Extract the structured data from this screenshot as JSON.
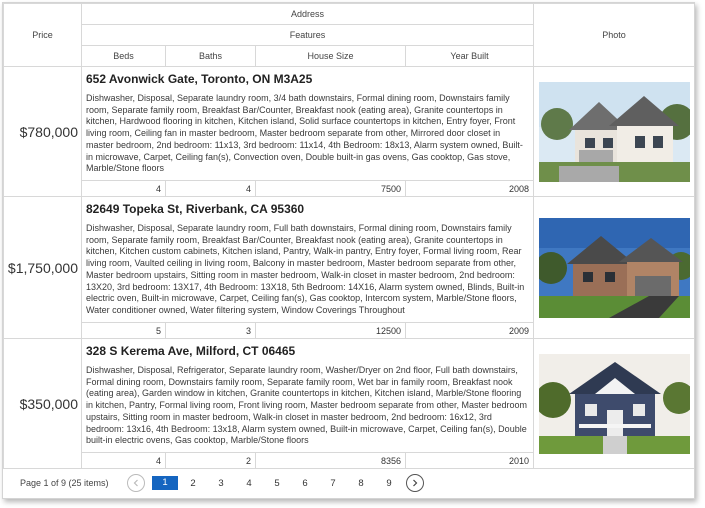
{
  "header": {
    "price": "Price",
    "address": "Address",
    "features": "Features",
    "beds": "Beds",
    "baths": "Baths",
    "house_size": "House Size",
    "year_built": "Year Built",
    "photo": "Photo"
  },
  "rows": [
    {
      "price": "$780,000",
      "address": "652 Avonwick Gate, Toronto, ON M3A25",
      "features": "Dishwasher, Disposal, Separate laundry room, 3/4 bath downstairs, Formal dining room, Downstairs family room, Separate family room, Breakfast Bar/Counter, Breakfast nook (eating area), Granite countertops in kitchen, Hardwood flooring in kitchen, Kitchen island, Solid surface countertops in kitchen, Entry foyer, Front living room, Ceiling fan in master bedroom, Master bedroom separate from other, Mirrored door closet in master bedroom, 2nd bedroom: 11x13, 3rd bedroom: 11x14, 4th Bedroom: 18x13, Alarm system owned, Built-in microwave, Carpet, Ceiling fan(s), Convection oven, Double built-in gas ovens, Gas cooktop, Gas stove, Marble/Stone floors",
      "beds": "4",
      "baths": "4",
      "house_size": "7500",
      "year_built": "2008"
    },
    {
      "price": "$1,750,000",
      "address": "82649 Topeka St, Riverbank, CA 95360",
      "features": "Dishwasher, Disposal, Separate laundry room, Full bath downstairs, Formal dining room, Downstairs family room, Separate family room, Breakfast Bar/Counter, Breakfast nook (eating area), Granite countertops in kitchen, Kitchen custom cabinets, Kitchen island, Pantry, Walk-in pantry, Entry foyer, Formal living room, Rear living room, Vaulted ceiling in living room, Balcony in master bedroom, Master bedroom separate from other, Master bedroom upstairs, Sitting room in master bedroom, Walk-in closet in master bedroom, 2nd bedroom: 13X20, 3rd bedroom: 13X17, 4th Bedroom: 13X18, 5th Bedroom: 14X16, Alarm system owned, Blinds, Built-in electric oven, Built-in microwave, Carpet, Ceiling fan(s), Gas cooktop, Intercom system, Marble/Stone floors, Water conditioner owned, Water filtering system, Window Coverings Throughout",
      "beds": "5",
      "baths": "3",
      "house_size": "12500",
      "year_built": "2009"
    },
    {
      "price": "$350,000",
      "address": "328 S Kerema Ave, Milford, CT 06465",
      "features": "Dishwasher, Disposal, Refrigerator, Separate laundry room, Washer/Dryer on 2nd floor, Full bath downstairs, Formal dining room, Downstairs family room, Separate family room, Wet bar in family room, Breakfast nook (eating area), Garden window in kitchen, Granite countertops in kitchen, Kitchen island, Marble/Stone flooring in kitchen, Pantry, Formal living room, Front living room, Master bedroom separate from other, Master bedroom upstairs, Sitting room in master bedroom, Walk-in closet in master bedroom, 2nd bedroom: 16x12, 3rd bedroom: 13x16, 4th Bedroom: 13x18, Alarm system owned, Built-in microwave, Carpet, Ceiling fan(s), Double built-in electric ovens, Gas cooktop, Marble/Stone floors",
      "beds": "4",
      "baths": "2",
      "house_size": "8356",
      "year_built": "2010"
    }
  ],
  "pager": {
    "info": "Page 1 of 9 (25 items)",
    "pages": [
      "1",
      "2",
      "3",
      "4",
      "5",
      "6",
      "7",
      "8",
      "9"
    ],
    "current_index": 0,
    "prev_icon": "chevron-left-icon",
    "next_icon": "chevron-right-icon"
  },
  "colors": {
    "accent": "#1565c0",
    "border": "#d8d8d8"
  }
}
